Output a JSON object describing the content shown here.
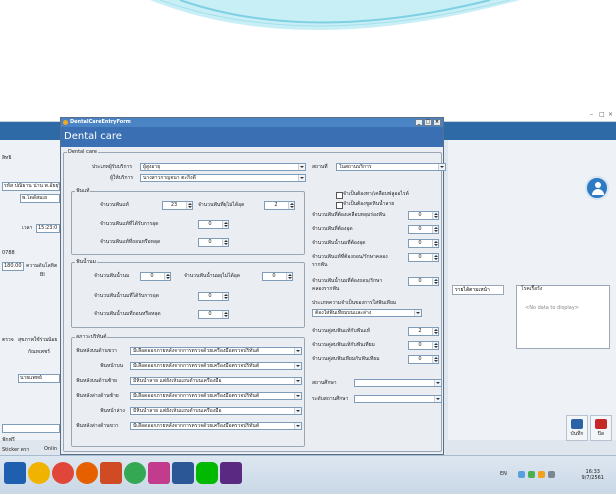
{
  "window": {
    "title": "DentalCareEntryForm",
    "header": "Dental care",
    "controls": [
      "_",
      "□",
      "×"
    ]
  },
  "background_app": {
    "left_rows": [
      "สิทธิ",
      "รหัส ปณิธาน น่าน พ.อัยยุรี",
      "พ.โดดัสมเย",
      "เวลา",
      "15:23:0",
      "0788",
      "180.00",
      "ความดันโลหิต",
      "Bl",
      "รายการ",
      "ต้องเงิน",
      "ยอด",
      "ทั้งหมด"
    ],
    "left_panel_labels": [
      "ตรวจ",
      "สุขภาพใช้ร่วม",
      "น้อย",
      "กัณหเพชร์",
      "นายแพทย์",
      "ฟักฟรี",
      "Sticker ตรา",
      "Onlin"
    ],
    "right_box_title": "โรคเรื้อรัง",
    "right_box_empty": "<No data to display>",
    "right_tab_label": "รายได้ตามเหน้า",
    "buttons": [
      {
        "label": "บันทึก",
        "color": "#2c63a8"
      },
      {
        "label": "ปิด",
        "color": "#c62828"
      }
    ]
  },
  "dialog": {
    "dental_care_legend": "Dental care",
    "service_point_label": "ประเภทผู้รับบริการ",
    "service_point_value": "ผู้สูงอายุ",
    "place_label": "สถานที่",
    "place_value": "ในสถานบริการ",
    "provider_label": "ผู้ให้บริการ",
    "provider_value": "นางสาวกาญจนา ตะกิ่งดี",
    "teeth_group": {
      "legend": "ฟันแท้",
      "rows": [
        {
          "label": "จำนวนฟันแท้",
          "value": "23"
        },
        {
          "label": "จำนวนฟันแท้ที่ได้รับการอุด",
          "value": "0"
        },
        {
          "label": "จำนวนฟันแท้ที่ถอนหรือหลุด",
          "value": "0"
        }
      ],
      "right_label": "จำนวนฟันที่ผุไม่ได้อุด",
      "right_value": "2"
    },
    "milk_group": {
      "legend": "ฟันน้ำนม",
      "rows": [
        {
          "label": "จำนวนฟันน้ำนม",
          "value": "0"
        },
        {
          "label": "จำนวนฟันน้ำนมที่ได้รับการอุด",
          "value": "0"
        },
        {
          "label": "จำนวนฟันน้ำนมที่ถอนหรือหลุด",
          "value": "0"
        }
      ],
      "right_label": "จำนวนฟันน้ำนมผุไม่ได้อุด",
      "right_value": "0"
    },
    "gum_group": {
      "legend": "สภาวะปริทันต์",
      "rows": [
        {
          "label": "ฟันหลังบนด้านขวา",
          "value": "มีเลือดออกภายหลังจากการตรวจด้วยเครื่องมือตรวจปริทันต์"
        },
        {
          "label": "ฟันหน้าบน",
          "value": "มีเลือดออกภายหลังจากการตรวจด้วยเครื่องมือตรวจปริทันต์"
        },
        {
          "label": "ฟันหลังบนด้านซ้าย",
          "value": "มีหินน้ำลาย แต่ยังเห็นแถบดำบนเครื่องมือ"
        },
        {
          "label": "ฟันหลังล่างด้านซ้าย",
          "value": "มีเลือดออกภายหลังจากการตรวจด้วยเครื่องมือตรวจปริทันต์"
        },
        {
          "label": "ฟันหน้าล่าง",
          "value": "มีหินน้ำลาย แต่ยังเห็นแถบดำบนเครื่องมือ"
        },
        {
          "label": "ฟันหลังล่างด้านขวา",
          "value": "มีเลือดออกภายหลังจากการตรวจด้วยเครื่องมือตรวจปริทันต์"
        }
      ]
    },
    "right_col": {
      "checkboxes": [
        "จำเป็นต้องทา/เคลือบฟลูออไรด์",
        "จำเป็นต้องขูดหินน้ำลาย"
      ],
      "rows": [
        {
          "label": "จำนวนฟันที่ต้องเคลือบหลุมร่องฟัน",
          "value": "0"
        },
        {
          "label": "จำนวนฟันที่ต้องอุด",
          "value": "0"
        },
        {
          "label": "จำนวนฟันน้ำนมที่ต้องอุด",
          "value": "0"
        },
        {
          "label": "จำนวนฟันแท้ที่ต้องถอน/รักษาคลองรากฟัน",
          "value": "0"
        },
        {
          "label": "จำนวนฟันน้ำนมที่ต้องถอน/รักษาคลองรากฟัน",
          "value": "0"
        }
      ],
      "denture_label": "ประเภทความจำเป็นของการใส่ฟันเทียม",
      "denture_value": "ต้องใส่ฟันเทียมบนและล่าง",
      "pairs": [
        {
          "label": "จำนวนคู่สบฟันแท้กับฟันแท้",
          "value": "2"
        },
        {
          "label": "จำนวนคู่สบฟันแท้กับฟันเทียม",
          "value": "0"
        },
        {
          "label": "จำนวนคู่สบฟันเทียมกับฟันเทียม",
          "value": "0"
        }
      ],
      "school_label": "สถานศึกษา",
      "class_label": "ระดับสถานศึกษา"
    }
  },
  "taskbar": {
    "icons": [
      {
        "name": "start",
        "color": "#1e5fb0"
      },
      {
        "name": "chrome",
        "color": "#f0b400"
      },
      {
        "name": "chrome-2",
        "color": "#e0463a"
      },
      {
        "name": "firefox",
        "color": "#e66000"
      },
      {
        "name": "powerpoint",
        "color": "#d04a23"
      },
      {
        "name": "chrome-3",
        "color": "#34a853"
      },
      {
        "name": "onenote",
        "color": "#c23b8c"
      },
      {
        "name": "word",
        "color": "#2b5797"
      },
      {
        "name": "line",
        "color": "#00b900"
      },
      {
        "name": "app",
        "color": "#5a2a82"
      }
    ],
    "lang": "EN",
    "time": "16:33",
    "date": "9/7/2561"
  }
}
